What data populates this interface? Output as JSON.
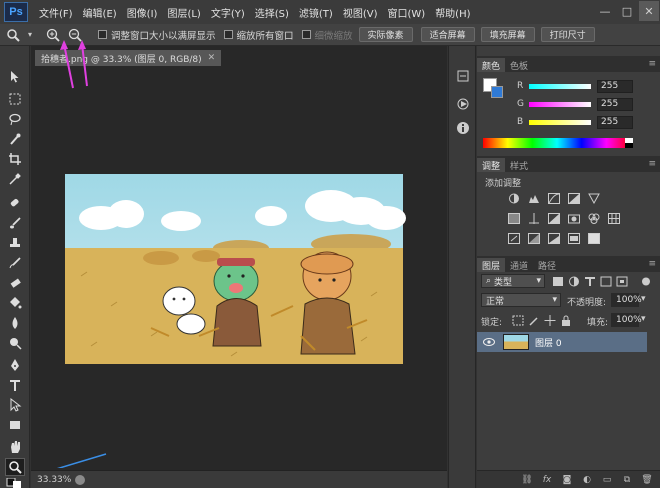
{
  "app": {
    "logo": "Ps"
  },
  "menu": [
    "文件(F)",
    "编辑(E)",
    "图像(I)",
    "图层(L)",
    "文字(Y)",
    "选择(S)",
    "滤镜(T)",
    "视图(V)",
    "窗口(W)",
    "帮助(H)"
  ],
  "options": {
    "checkboxes": [
      "调整窗口大小以满屏显示",
      "缩放所有窗口",
      "细微缩放"
    ],
    "buttons": [
      "实际像素",
      "适合屏幕",
      "填充屏幕",
      "打印尺寸"
    ]
  },
  "document": {
    "tab_title": "拾穗者.png @ 33.3% (图层 0, RGB/8)",
    "zoom": "33.33%"
  },
  "color_panel": {
    "tabs": [
      "颜色",
      "色板"
    ],
    "channels": [
      {
        "label": "R",
        "value": "255"
      },
      {
        "label": "G",
        "value": "255"
      },
      {
        "label": "B",
        "value": "255"
      }
    ]
  },
  "adjust_panel": {
    "tabs": [
      "调整",
      "样式"
    ],
    "title": "添加调整"
  },
  "layers_panel": {
    "tabs": [
      "图层",
      "通道",
      "路径"
    ],
    "filter": "类型",
    "blend_mode": "正常",
    "opacity_label": "不透明度:",
    "opacity_value": "100%",
    "lock_label": "锁定:",
    "fill_label": "填充:",
    "fill_value": "100%",
    "layer_name": "图层 0"
  },
  "colors": {
    "accent": "#2f7ad6",
    "annotation_arrow": "#e040e0",
    "annotation_blue": "#3a8ee6"
  }
}
